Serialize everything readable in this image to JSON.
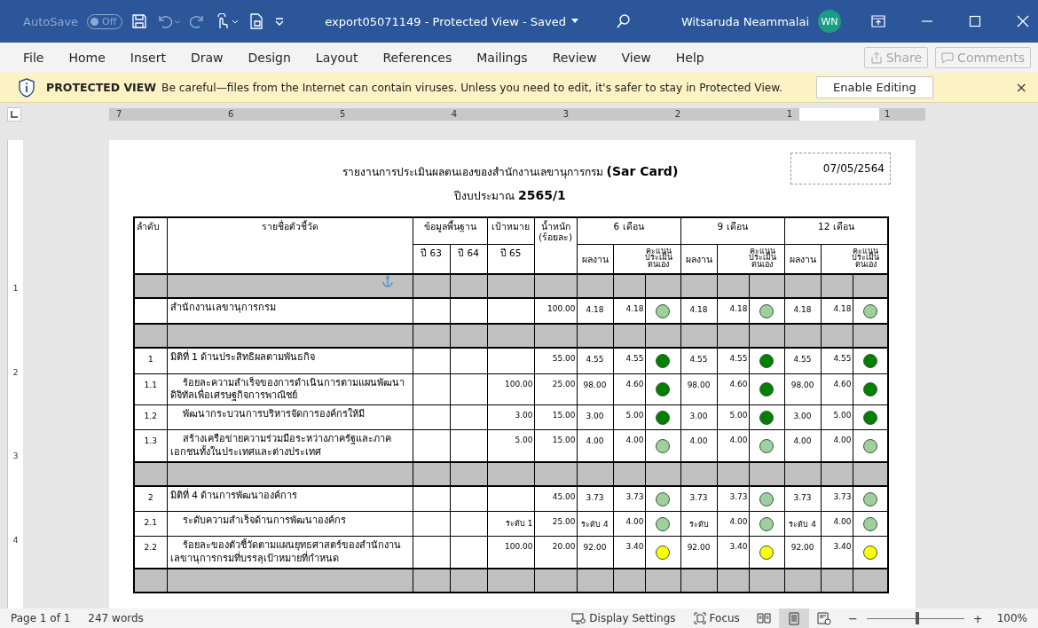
{
  "window": {
    "autosave": {
      "label": "AutoSave",
      "state": "Off",
      "on": false
    },
    "title": "export05071149  -  Protected View  -  Saved",
    "user": "Witsaruda Neammalai",
    "initials": "WN"
  },
  "ribbon": {
    "tabs": [
      {
        "label": "File",
        "selected": false
      },
      {
        "label": "Home",
        "selected": false
      },
      {
        "label": "Insert",
        "selected": false
      },
      {
        "label": "Draw",
        "selected": false
      },
      {
        "label": "Design",
        "selected": false
      },
      {
        "label": "Layout",
        "selected": false
      },
      {
        "label": "References",
        "selected": false
      },
      {
        "label": "Mailings",
        "selected": false
      },
      {
        "label": "Review",
        "selected": false
      },
      {
        "label": "View",
        "selected": false
      },
      {
        "label": "Help",
        "selected": false
      }
    ],
    "share": {
      "label": "Share",
      "disabled": true
    },
    "comments": {
      "label": "Comments",
      "disabled": true
    }
  },
  "protected_bar": {
    "title": "PROTECTED VIEW",
    "message": "Be careful—files from the Internet can contain viruses. Unless you need to edit, it's safer to stay in Protected View.",
    "button": "Enable Editing",
    "close": "×"
  },
  "ruler": {
    "labels": [
      "7",
      "6",
      "5",
      "4",
      "3",
      "2",
      "1",
      "1"
    ]
  },
  "vertical_ruler": {
    "labels": [
      "1",
      "2",
      "3",
      "4"
    ]
  },
  "document": {
    "title": "รายงานการประเมินผลตนเองของสำนักงานเลขานุการกรม **(Sar Card)**",
    "subtitle": "ปีงบประมาณ **2565/1**",
    "date": "07/05/2564",
    "table": {
      "headers": {
        "number": "ลำดับ",
        "name": "รายชื่อตัวชี้วัด",
        "baseline": "ข้อมูลพื้นฐาน",
        "baseline_years": [
          "ปี 63",
          "ปี 64"
        ],
        "target": "เป้าหมาย",
        "target_year": "ปี 65",
        "weight": "น้ำหนัก (ร้อยละ)",
        "periods": [
          {
            "label": "6 เดือน",
            "result": "ผลงาน",
            "score": "คะแนน ประเมิน ตนเอง"
          },
          {
            "label": "9 เดือน",
            "result": "ผลงาน",
            "score": "คะแนน ประเมิน ตนเอง"
          },
          {
            "label": "12 เดือน",
            "result": "ผลงาน",
            "score": "คะแนน ประเมิน ตนเอง"
          }
        ]
      },
      "rows": [
        {
          "kind": "band",
          "anchor": true
        },
        {
          "kind": "item",
          "name": "สำนักงานเลขานุการกรม",
          "weight": "100.00",
          "periods": [
            {
              "result": "4.18",
              "score": "4.18",
              "color": "#9fcf9f"
            },
            {
              "result": "4.18",
              "score": "4.18",
              "color": "#9fcf9f"
            },
            {
              "result": "4.18",
              "score": "4.18",
              "color": "#9fcf9f"
            }
          ]
        },
        {
          "kind": "band",
          "anchor": false
        },
        {
          "kind": "item",
          "number": "1",
          "name": "มิติที่ 1 ด้านประสิทธิผลตามพันธกิจ",
          "weight": "55.00",
          "periods": [
            {
              "result": "4.55",
              "score": "4.55",
              "color": "#008000"
            },
            {
              "result": "4.55",
              "score": "4.55",
              "color": "#008000"
            },
            {
              "result": "4.55",
              "score": "4.55",
              "color": "#008000"
            }
          ],
          "children": [
            {
              "number": "1.1",
              "name": "ร้อยละความสำเร็จของการดำเนินการตามแผนพัฒนาดิจิทัลเพื่อเศรษฐกิจการพาณิชย์",
              "target": "100.00",
              "weight": "25.00",
              "periods": [
                {
                  "result": "98.00",
                  "score": "4.60",
                  "color": "#008000"
                },
                {
                  "result": "98.00",
                  "score": "4.60",
                  "color": "#008000"
                },
                {
                  "result": "98.00",
                  "score": "4.60",
                  "color": "#008000"
                }
              ]
            },
            {
              "number": "1.2",
              "name": "พัฒนากระบวนการบริหารจัดการองค์กรให้มี",
              "target": "3.00",
              "weight": "15.00",
              "periods": [
                {
                  "result": "3.00",
                  "score": "5.00",
                  "color": "#008000"
                },
                {
                  "result": "3.00",
                  "score": "5.00",
                  "color": "#008000"
                },
                {
                  "result": "3.00",
                  "score": "5.00",
                  "color": "#008000"
                }
              ]
            },
            {
              "number": "1.3",
              "name": "สร้างเครือข่ายความร่วมมือระหว่างภาครัฐและภาคเอกชนทั้งในประเทศและต่างประเทศ",
              "target": "5.00",
              "weight": "15.00",
              "periods": [
                {
                  "result": "4.00",
                  "score": "4.00",
                  "color": "#9fcf9f"
                },
                {
                  "result": "4.00",
                  "score": "4.00",
                  "color": "#9fcf9f"
                },
                {
                  "result": "4.00",
                  "score": "4.00",
                  "color": "#9fcf9f"
                }
              ]
            }
          ]
        },
        {
          "kind": "band",
          "anchor": false
        },
        {
          "kind": "item",
          "number": "2",
          "name": "มิติที่ 4 ด้านการพัฒนาองค์การ",
          "weight": "45.00",
          "periods": [
            {
              "result": "3.73",
              "score": "3.73",
              "color": "#9fcf9f"
            },
            {
              "result": "3.73",
              "score": "3.73",
              "color": "#9fcf9f"
            },
            {
              "result": "3.73",
              "score": "3.73",
              "color": "#9fcf9f"
            }
          ],
          "children": [
            {
              "number": "2.1",
              "name": "ระดับความสำเร็จด้านการพัฒนาองค์กร",
              "target": "ระดับ 1",
              "weight": "25.00",
              "periods": [
                {
                  "result": "ระดับ 4",
                  "score": "4.00",
                  "color": "#9fcf9f"
                },
                {
                  "result": "ระดับ",
                  "score": "4.00",
                  "color": "#9fcf9f"
                },
                {
                  "result": "ระดับ 4",
                  "score": "4.00",
                  "color": "#9fcf9f"
                }
              ]
            },
            {
              "number": "2.2",
              "name": "ร้อยละของตัวชี้วัดตามแผนยุทธศาสตร์ของสำนักงานเลขานุการกรมที่บรรลุเป้าหมายที่กำหนด",
              "target": "100.00",
              "weight": "20.00",
              "periods": [
                {
                  "result": "92.00",
                  "score": "3.40",
                  "color": "#ffff00"
                },
                {
                  "result": "92.00",
                  "score": "3.40",
                  "color": "#ffff00"
                },
                {
                  "result": "92.00",
                  "score": "3.40",
                  "color": "#ffff00"
                }
              ]
            }
          ]
        },
        {
          "kind": "band",
          "anchor": false
        }
      ]
    }
  },
  "status_bar": {
    "page": "Page 1 of 1",
    "words": "247 words",
    "display_settings": "Display Settings",
    "focus": "Focus",
    "views": [
      {
        "kind": "read",
        "selected": false
      },
      {
        "kind": "print",
        "selected": true
      },
      {
        "kind": "web",
        "selected": false
      }
    ],
    "zoom_out": "−",
    "zoom": {
      "level": 0.52
    },
    "zoom_in": "+",
    "zoom_percent": "100%"
  }
}
